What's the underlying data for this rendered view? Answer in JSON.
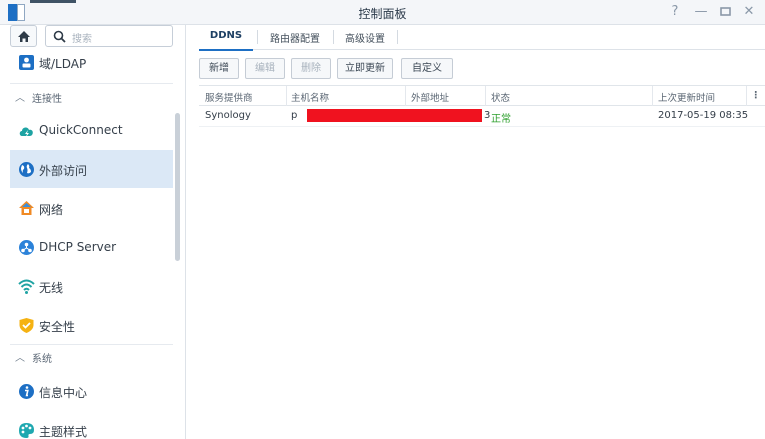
{
  "window": {
    "title": "控制面板",
    "buttons": [
      "help-icon",
      "minimize-icon",
      "maximize-icon",
      "close-icon"
    ]
  },
  "sidebar": {
    "search_placeholder": "搜索",
    "items": [
      {
        "id": "domain",
        "label": "域/LDAP",
        "icon": "domain-ldap-icon"
      },
      {
        "id": "quickconnect",
        "label": "QuickConnect",
        "icon": "quickconnect-icon"
      },
      {
        "id": "external-access",
        "label": "外部访问",
        "icon": "globe-icon",
        "selected": true
      },
      {
        "id": "network",
        "label": "网络",
        "icon": "network-house-icon"
      },
      {
        "id": "dhcp",
        "label": "DHCP Server",
        "icon": "dhcp-icon"
      },
      {
        "id": "wireless",
        "label": "无线",
        "icon": "wifi-icon"
      },
      {
        "id": "security",
        "label": "安全性",
        "icon": "shield-icon"
      },
      {
        "id": "info-center",
        "label": "信息中心",
        "icon": "info-icon"
      },
      {
        "id": "theme",
        "label": "主题样式",
        "icon": "palette-icon"
      }
    ],
    "sections": [
      {
        "id": "connectivity",
        "label": "连接性",
        "icon": "chevron-up-icon"
      },
      {
        "id": "system",
        "label": "系统",
        "icon": "chevron-up-icon"
      }
    ]
  },
  "tabs": [
    {
      "id": "ddns",
      "label": "DDNS",
      "active": true
    },
    {
      "id": "router",
      "label": "路由器配置"
    },
    {
      "id": "advanced",
      "label": "高级设置"
    }
  ],
  "toolbar": {
    "add": "新增",
    "edit": "编辑",
    "delete": "删除",
    "update_now": "立即更新",
    "customize": "自定义"
  },
  "table": {
    "columns": [
      "服务提供商",
      "主机名称",
      "外部地址",
      "状态",
      "上次更新时间"
    ],
    "rows": [
      {
        "provider": "Synology",
        "hostname_prefix": "p",
        "address_suffix": "3",
        "status": "正常",
        "last_update": "2017-05-19 08:35"
      }
    ]
  },
  "colors": {
    "accent": "#1d6fc4",
    "selected_bg": "#dbe8f6",
    "status_ok": "#2c9f2c",
    "redaction": "#f0121f"
  }
}
